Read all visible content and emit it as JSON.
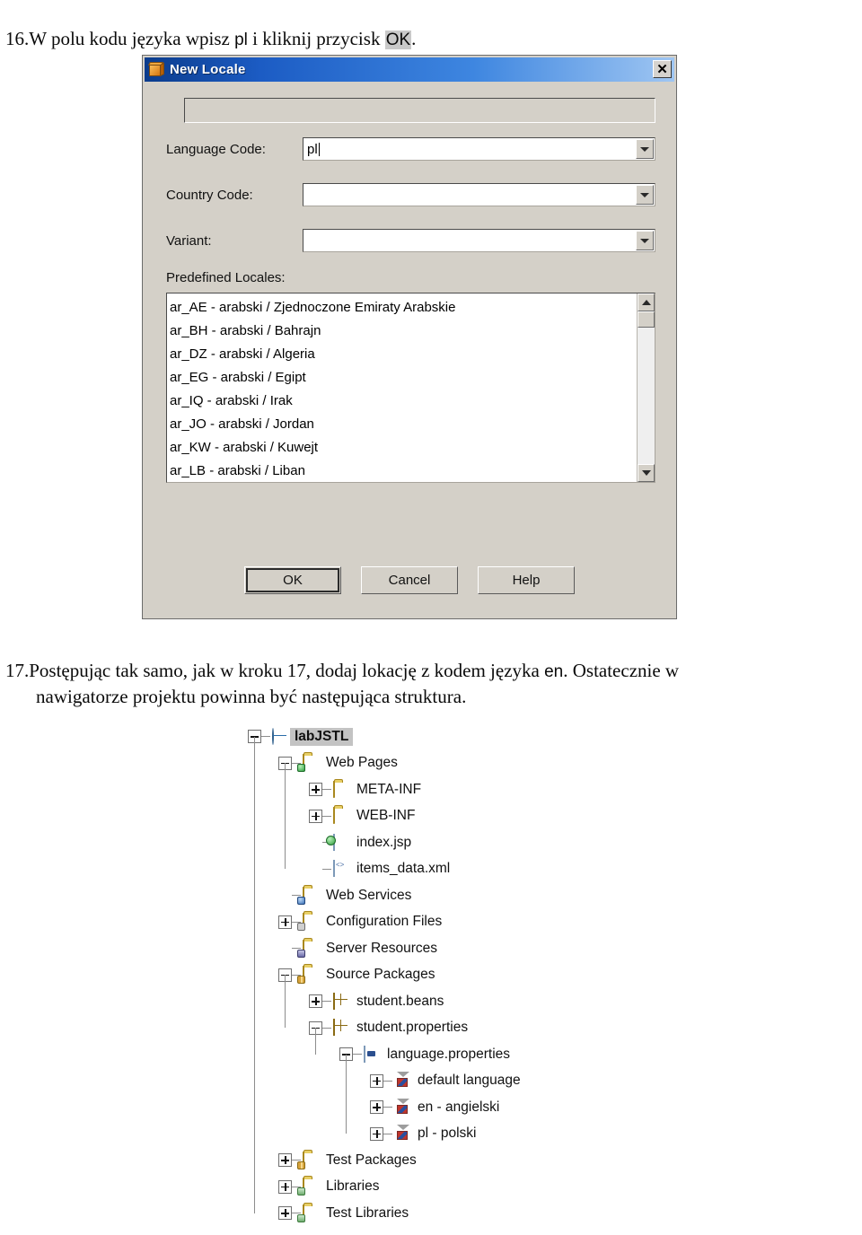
{
  "steps": {
    "step16": {
      "number": "16.",
      "part1": "W polu kodu języka wpisz ",
      "code": "pl",
      "part2": " i kliknij przycisk ",
      "button": "OK",
      "part3": "."
    },
    "step17": {
      "number": "17.",
      "part1": "Postępując tak samo, jak w kroku 17, dodaj lokację z kodem języka ",
      "code": "en",
      "part2": ". Ostatecznie w",
      "line2": "nawigatorze projektu powinna być następująca struktura."
    }
  },
  "dialog": {
    "title": "New Locale",
    "close_label": "✕",
    "preview_value": "",
    "fields": [
      {
        "label": "Language Code:",
        "value": "pl"
      },
      {
        "label": "Country Code:",
        "value": ""
      },
      {
        "label": "Variant:",
        "value": ""
      }
    ],
    "locales_caption": "Predefined Locales:",
    "locales": [
      "ar_AE - arabski / Zjednoczone Emiraty Arabskie",
      "ar_BH - arabski / Bahrajn",
      "ar_DZ - arabski / Algeria",
      "ar_EG - arabski / Egipt",
      "ar_IQ - arabski / Irak",
      "ar_JO - arabski / Jordan",
      "ar_KW - arabski / Kuwejt",
      "ar_LB - arabski / Liban"
    ],
    "buttons": [
      {
        "label": "OK"
      },
      {
        "label": "Cancel"
      },
      {
        "label": "Help"
      }
    ]
  },
  "tree": {
    "nodes": [
      {
        "label": "labJSTL",
        "level": 0,
        "toggle": "minus",
        "icon": "globe"
      },
      {
        "label": "Web Pages",
        "level": 1,
        "toggle": "minus",
        "icon": "folder-web"
      },
      {
        "label": "META-INF",
        "level": 2,
        "toggle": "plus",
        "icon": "folder"
      },
      {
        "label": "WEB-INF",
        "level": 2,
        "toggle": "plus",
        "icon": "folder"
      },
      {
        "label": "index.jsp",
        "level": 2,
        "toggle": "none",
        "icon": "file-jsp"
      },
      {
        "label": "items_data.xml",
        "level": 2,
        "toggle": "none",
        "icon": "file-xml"
      },
      {
        "label": "Web Services",
        "level": 1,
        "toggle": "none",
        "icon": "folder-services"
      },
      {
        "label": "Configuration Files",
        "level": 1,
        "toggle": "plus",
        "icon": "folder-config"
      },
      {
        "label": "Server Resources",
        "level": 1,
        "toggle": "none",
        "icon": "folder-server"
      },
      {
        "label": "Source Packages",
        "level": 1,
        "toggle": "minus",
        "icon": "folder-packages"
      },
      {
        "label": "student.beans",
        "level": 2,
        "toggle": "plus",
        "icon": "package"
      },
      {
        "label": "student.properties",
        "level": 2,
        "toggle": "minus",
        "icon": "package"
      },
      {
        "label": "language.properties",
        "level": 3,
        "toggle": "minus",
        "icon": "file-props"
      },
      {
        "label": "default language",
        "level": 4,
        "toggle": "plus",
        "icon": "locale"
      },
      {
        "label": "en - angielski",
        "level": 4,
        "toggle": "plus",
        "icon": "locale"
      },
      {
        "label": "pl - polski",
        "level": 4,
        "toggle": "plus",
        "icon": "locale"
      },
      {
        "label": "Test Packages",
        "level": 1,
        "toggle": "plus",
        "icon": "folder-packages"
      },
      {
        "label": "Libraries",
        "level": 1,
        "toggle": "plus",
        "icon": "folder-libs"
      },
      {
        "label": "Test Libraries",
        "level": 1,
        "toggle": "plus",
        "icon": "folder-libs"
      }
    ]
  },
  "colors": {
    "titlebar_start": "#0b3c8c",
    "titlebar_end": "#9fc6f2",
    "dialog_face": "#d4d0c8",
    "selection": "#c3c3c3",
    "folder": "#e8cf66"
  }
}
